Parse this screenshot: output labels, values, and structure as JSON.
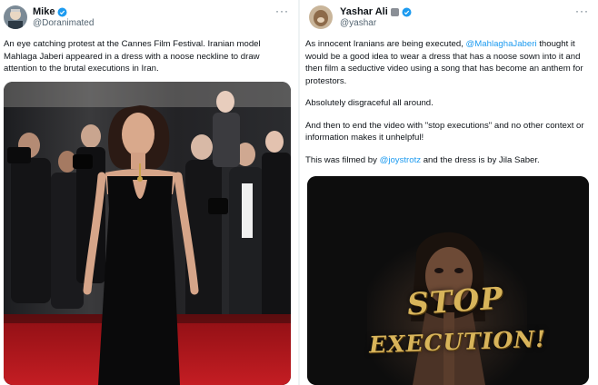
{
  "left_tweet": {
    "display_name": "Mike",
    "handle": "@Doranimated",
    "more_label": "···",
    "text": "An eye catching protest at the Cannes Film Festival. Iranian model Mahlaga Jaberi appeared in a dress with a noose neckline to draw attention to the brutal executions in Iran."
  },
  "right_tweet": {
    "display_name": "Yashar Ali",
    "handle": "@yashar",
    "more_label": "···",
    "para1_before": "As innocent Iranians are being executed, ",
    "para1_mention": "@MahlaghaJaberi",
    "para1_after": " thought it would be a good idea to wear a dress that has a noose sown into it and then film a seductive video using a song that has become an anthem for protestors.",
    "para2": "Absolutely disgraceful all around.",
    "para3": "And then to end the video with \"stop executions\" and no other context or information makes it unhelpful!",
    "para4_before": "This was filmed by ",
    "para4_mention": "@joystrotz",
    "para4_after": " and the dress is by Jila Saber.",
    "video_text_top": "STOP",
    "video_text_bottom": "EXECUTION!"
  },
  "colors": {
    "link": "#1d9bf0",
    "verified": "#1d9bf0",
    "carpet": "#b3171d",
    "text": "#0f1419",
    "secondary": "#536471"
  }
}
